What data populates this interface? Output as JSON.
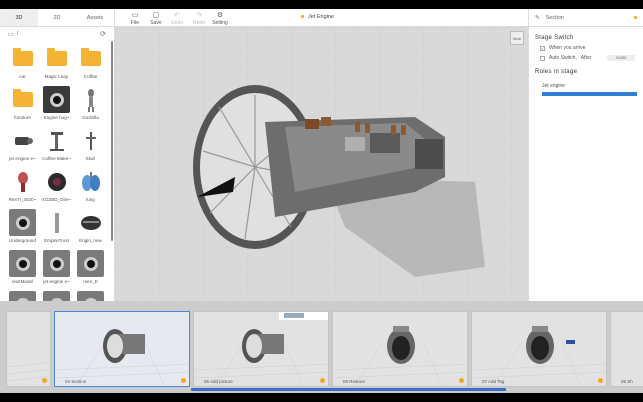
{
  "left_panel": {
    "tabs": [
      {
        "label": "3D",
        "active": true
      },
      {
        "label": "2D",
        "active": false
      },
      {
        "label": "Assets",
        "active": false
      }
    ],
    "path": "/",
    "assets": [
      {
        "label": "car",
        "kind": "folder"
      },
      {
        "label": "Magic Leap",
        "kind": "folder"
      },
      {
        "label": "Coffee",
        "kind": "folder"
      },
      {
        "label": "furniture",
        "kind": "folder"
      },
      {
        "label": "Engine hug~",
        "kind": "engine"
      },
      {
        "label": "Godzilla",
        "kind": "figure"
      },
      {
        "label": "jet engine e~",
        "kind": "object"
      },
      {
        "label": "Coffee Make~",
        "kind": "object"
      },
      {
        "label": "Skull",
        "kind": "object"
      },
      {
        "label": "RenTi_2020~",
        "kind": "object"
      },
      {
        "label": "XGZBD_Dire~",
        "kind": "object"
      },
      {
        "label": "lung",
        "kind": "object"
      },
      {
        "label": "Underground",
        "kind": "engine"
      },
      {
        "label": "EmpireTrust",
        "kind": "object"
      },
      {
        "label": "Engin_new",
        "kind": "object"
      },
      {
        "label": "revitModel",
        "kind": "engine"
      },
      {
        "label": "jet engine e~",
        "kind": "engine"
      },
      {
        "label": "men_E",
        "kind": "engine"
      },
      {
        "label": "",
        "kind": "engine"
      },
      {
        "label": "",
        "kind": "engine"
      },
      {
        "label": "",
        "kind": "engine"
      }
    ]
  },
  "toolbar": {
    "file": "File",
    "save": "Save",
    "undo": "Undo",
    "redo": "Redo",
    "setting": "Setting",
    "title": "Jet Engine"
  },
  "viewport": {
    "view_button": "Mode"
  },
  "right_panel": {
    "header": "Section",
    "stage_switch_title": "Stage Switch",
    "when_arrive": "When you arrive",
    "when_arrive_checked": true,
    "auto_switch": "Auto Switch,",
    "auto_switch_checked": false,
    "after_label": "After",
    "after_value": "5.000",
    "roles_title": "Roles in stage",
    "role_name": "Jet engine",
    "accent_color": "#2f7fd6"
  },
  "timeline": {
    "slides": [
      {
        "label": "",
        "active": false
      },
      {
        "label": "04  Section",
        "active": true
      },
      {
        "label": "05  Add picture",
        "active": false
      },
      {
        "label": "06  Restore",
        "active": false
      },
      {
        "label": "07  Add Tag",
        "active": false
      },
      {
        "label": "08  Sh",
        "active": false
      }
    ]
  }
}
